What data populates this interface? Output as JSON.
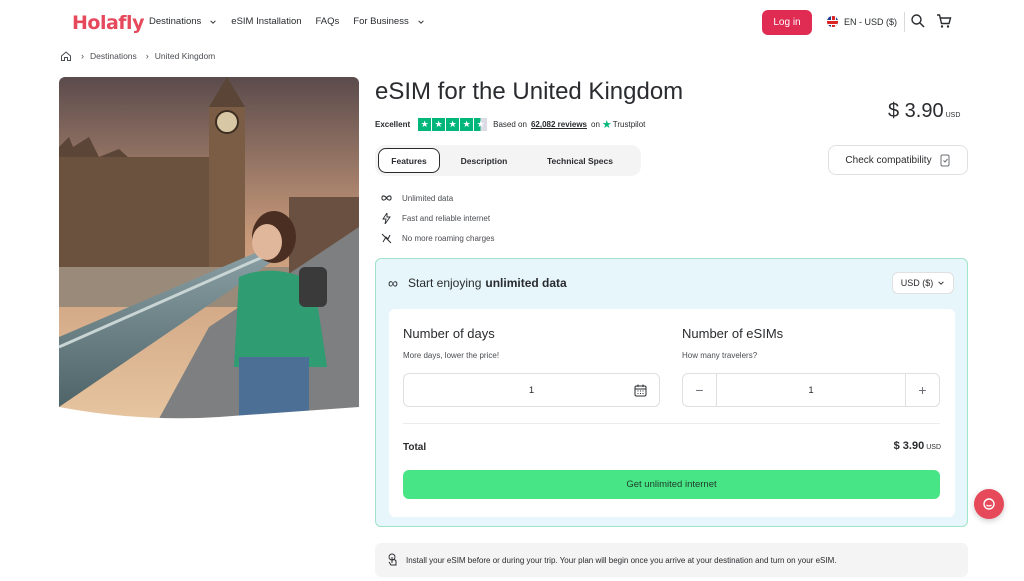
{
  "brand": {
    "logo": "Holafly",
    "accent": "#e02c53",
    "cta_color": "#48e586"
  },
  "nav": {
    "items": [
      {
        "label": "Destinations",
        "has_dropdown": true
      },
      {
        "label": "eSIM Installation",
        "has_dropdown": false
      },
      {
        "label": "FAQs",
        "has_dropdown": false
      },
      {
        "label": "For Business",
        "has_dropdown": true
      }
    ],
    "login": "Log in",
    "language": "EN - USD ($)"
  },
  "breadcrumb": {
    "items": [
      "Destinations",
      "United Kingdom"
    ]
  },
  "product": {
    "title": "eSIM for the United Kingdom",
    "price": "$ 3.90",
    "currency": "USD",
    "rating": {
      "label": "Excellent",
      "stars": 4.5,
      "prefix": "Based on",
      "reviews": "62,082 reviews",
      "on": "on",
      "provider": "Trustpilot"
    },
    "tabs": [
      "Features",
      "Description",
      "Technical Specs"
    ],
    "check_compat": "Check compatibility",
    "features": [
      {
        "icon": "infinity-icon",
        "label": "Unlimited data"
      },
      {
        "icon": "lightning-icon",
        "label": "Fast and reliable internet"
      },
      {
        "icon": "no-roaming-icon",
        "label": "No more roaming charges"
      }
    ]
  },
  "plan": {
    "heading_prefix": "Start enjoying",
    "heading_bold": "unlimited data",
    "currency_select": "USD ($)",
    "days": {
      "title": "Number of days",
      "subtitle": "More days, lower the price!",
      "value": "1"
    },
    "esims": {
      "title": "Number of eSIMs",
      "subtitle": "How many travelers?",
      "value": "1",
      "minus": "−",
      "plus": "+"
    },
    "total_label": "Total",
    "total_value": "$ 3.90",
    "total_currency": "USD",
    "cta": "Get unlimited internet"
  },
  "banner": {
    "text": "Install your eSIM before or during your trip. Your plan will begin once you arrive at your destination and turn on your eSIM."
  }
}
